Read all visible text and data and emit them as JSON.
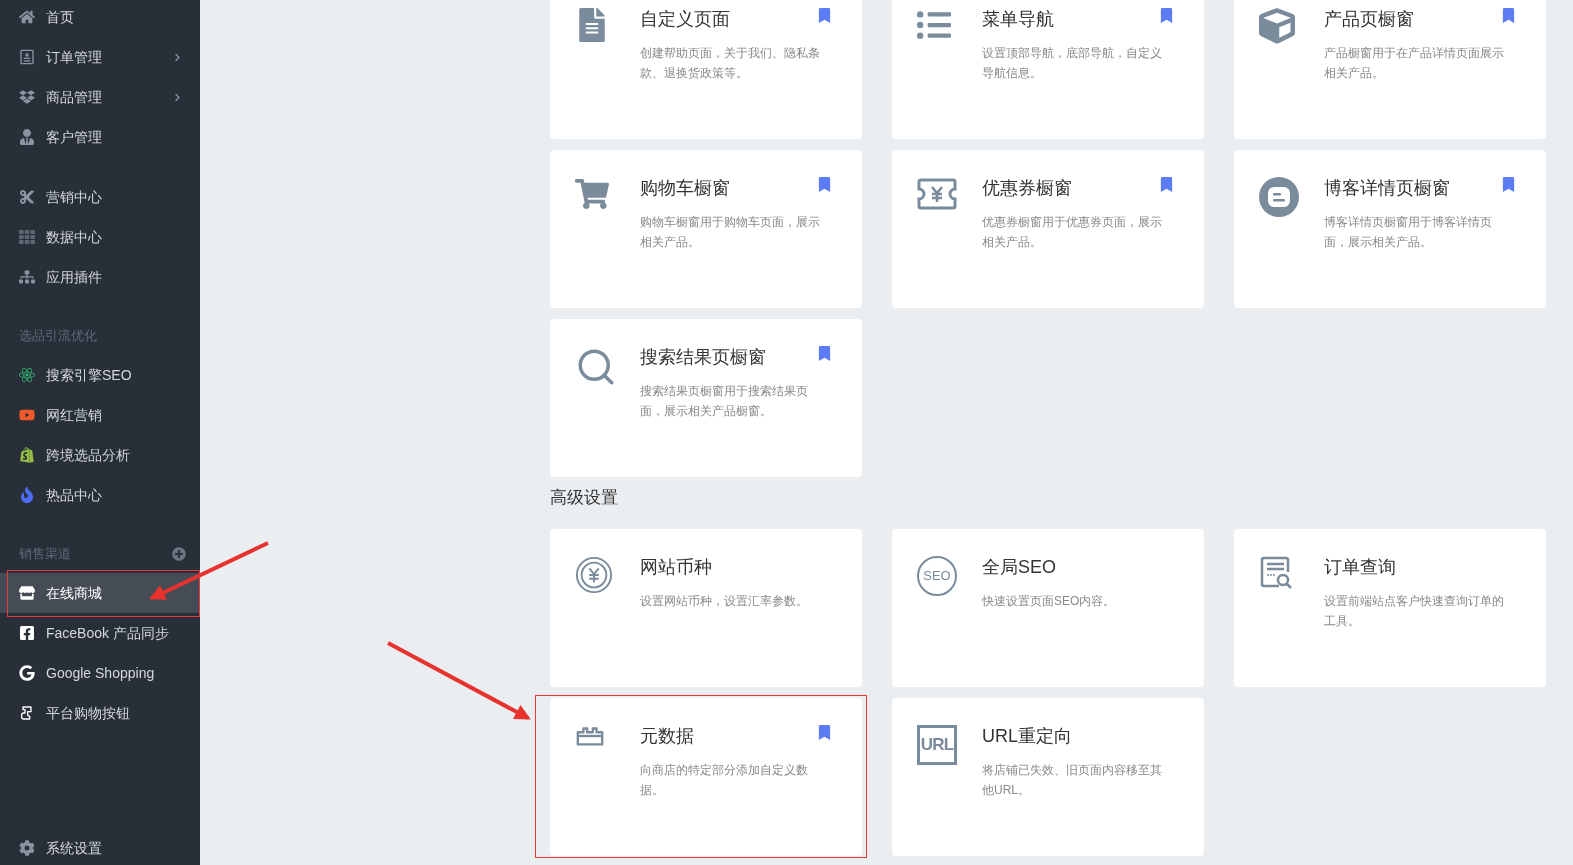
{
  "sidebar": {
    "sections": [
      {
        "items": [
          {
            "label": "首页",
            "has_submenu": false,
            "selected": false,
            "highlighted": false
          },
          {
            "label": "订单管理",
            "has_submenu": true,
            "selected": false,
            "highlighted": false
          },
          {
            "label": "商品管理",
            "has_submenu": true,
            "selected": false,
            "highlighted": false
          },
          {
            "label": "客户管理",
            "has_submenu": false,
            "selected": false,
            "highlighted": false
          }
        ]
      },
      {
        "items": [
          {
            "label": "营销中心",
            "has_submenu": false,
            "selected": false,
            "highlighted": false
          },
          {
            "label": "数据中心",
            "has_submenu": false,
            "selected": false,
            "highlighted": false
          },
          {
            "label": "应用插件",
            "has_submenu": false,
            "selected": false,
            "highlighted": false
          }
        ]
      },
      {
        "heading": "选品引流优化",
        "items": [
          {
            "label": "搜索引擎SEO",
            "has_submenu": false,
            "selected": false,
            "highlighted": false
          },
          {
            "label": "网红营销",
            "has_submenu": false,
            "selected": false,
            "highlighted": false
          },
          {
            "label": "跨境选品分析",
            "has_submenu": false,
            "selected": false,
            "highlighted": false
          },
          {
            "label": "热品中心",
            "has_submenu": false,
            "selected": false,
            "highlighted": false
          }
        ]
      },
      {
        "heading": "销售渠道",
        "add_button": true,
        "items": [
          {
            "label": "在线商城",
            "has_submenu": false,
            "selected": true,
            "highlighted": true
          },
          {
            "label": "FaceBook 产品同步",
            "has_submenu": false,
            "selected": false,
            "highlighted": false
          },
          {
            "label": "Google Shopping",
            "has_submenu": false,
            "selected": false,
            "highlighted": false
          },
          {
            "label": "平台购物按钮",
            "has_submenu": false,
            "selected": false,
            "highlighted": false
          }
        ]
      }
    ],
    "footer_item": {
      "label": "系统设置"
    }
  },
  "groups": [
    {
      "cards": [
        {
          "title": "自定义页面",
          "description": "创建帮助页面，关于我们、隐私条款、退换货政策等。",
          "bookmarked": true,
          "highlighted": false
        },
        {
          "title": "菜单导航",
          "description": "设置顶部导航，底部导航，自定义导航信息。",
          "bookmarked": true,
          "highlighted": false
        },
        {
          "title": "产品页橱窗",
          "description": "产品橱窗用于在产品详情页面展示相关产品。",
          "bookmarked": true,
          "highlighted": false
        },
        {
          "title": "购物车橱窗",
          "description": "购物车橱窗用于购物车页面，展示相关产品。",
          "bookmarked": true,
          "highlighted": false
        },
        {
          "title": "优惠券橱窗",
          "description": "优惠券橱窗用于优惠券页面，展示相关产品。",
          "bookmarked": true,
          "highlighted": false
        },
        {
          "title": "博客详情页橱窗",
          "description": "博客详情页橱窗用于博客详情页面，展示相关产品。",
          "bookmarked": true,
          "highlighted": false
        },
        {
          "title": "搜索结果页橱窗",
          "description": "搜索结果页橱窗用于搜索结果页面，展示相关产品橱窗。",
          "bookmarked": true,
          "highlighted": false
        }
      ]
    },
    {
      "heading": "高级设置",
      "cards": [
        {
          "title": "网站币种",
          "description": "设置网站币种，设置汇率参数。",
          "bookmarked": false,
          "highlighted": false
        },
        {
          "title": "全局SEO",
          "icon_text": "SEO",
          "description": "快速设置页面SEO内容。",
          "bookmarked": false,
          "highlighted": false
        },
        {
          "title": "订单查询",
          "description": "设置前端站点客户快速查询订单的工具。",
          "bookmarked": false,
          "highlighted": false
        },
        {
          "title": "元数据",
          "description": "向商店的特定部分添加自定义数据。",
          "bookmarked": true,
          "highlighted": true
        },
        {
          "title": "URL重定向",
          "icon_text": "URL",
          "description": "将店铺已失效、旧页面内容移至其他URL。",
          "bookmarked": false,
          "highlighted": false
        }
      ]
    }
  ]
}
